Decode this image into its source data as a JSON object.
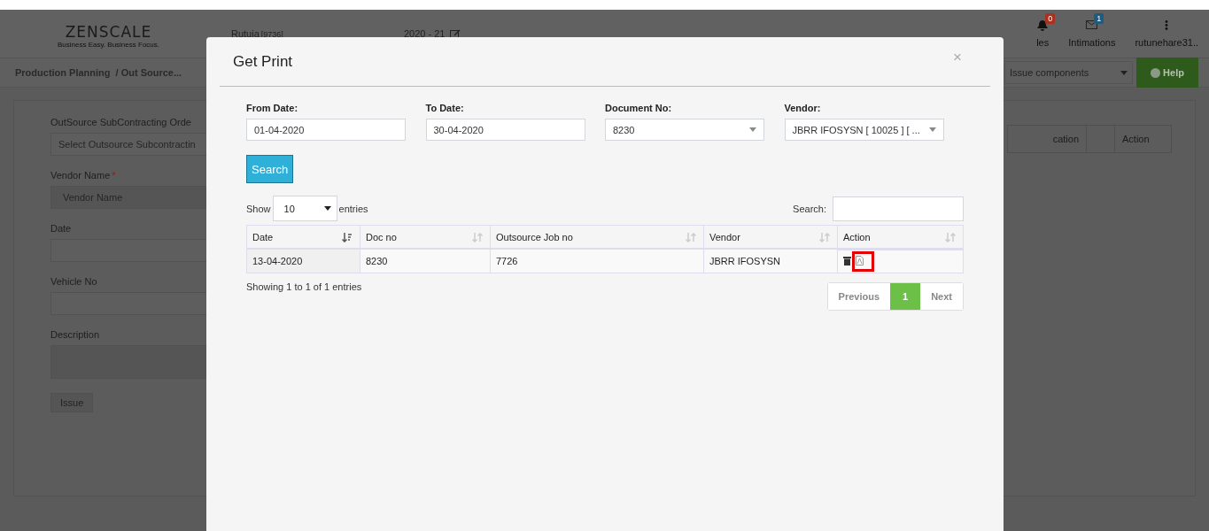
{
  "header": {
    "logo": "ZENSCALE",
    "tagline": "Business Easy. Business Focus.",
    "user": "Rutuja",
    "user_id": "[9736]",
    "year": "2020 - 21",
    "items": [
      {
        "kind": "bell",
        "label": "les",
        "badge": "0",
        "color": "#a8321f"
      },
      {
        "kind": "mail",
        "label": "Intimations",
        "badge": "1",
        "color": "#1f5a7f"
      },
      {
        "kind": "dots",
        "label": "rutunehare31.."
      }
    ]
  },
  "breadcrumb": [
    "Production Planning",
    "/ Out Source..."
  ],
  "type_select": {
    "value": "Issue components"
  },
  "help_button": "Help",
  "form": {
    "order_label": "OutSource SubContracting Orde",
    "order_placeholder": "Select Outsource Subcontractin",
    "vendor_label": "Vendor Name",
    "vendor_required": true,
    "vendor_required_mark": "*",
    "vendor_placeholder": "Vendor Name",
    "date_label": "Date",
    "vehicle_label": "Vehicle No",
    "description_label": "Description",
    "issue_button": "Issue"
  },
  "background_table": {
    "columns": [
      "cation",
      "",
      "Action"
    ]
  },
  "modal": {
    "title": "Get Print",
    "close": "×",
    "filters": [
      {
        "label": "From Date:",
        "value": "01-04-2020",
        "kind": "input"
      },
      {
        "label": "To Date:",
        "value": "30-04-2020",
        "kind": "input"
      },
      {
        "label": "Document No:",
        "value": "8230",
        "kind": "select"
      },
      {
        "label": "Vendor:",
        "value": "JBRR IFOSYSN [ 10025 ] [ ...",
        "kind": "select"
      }
    ],
    "search_button": "Search",
    "length": {
      "show": "Show",
      "value": "10",
      "entries": "entries"
    },
    "search_label": "Search:",
    "columns": [
      {
        "label": "Date",
        "sorted": true
      },
      {
        "label": "Doc no",
        "sorted": false
      },
      {
        "label": "Outsource Job no",
        "sorted": false
      },
      {
        "label": "Vendor",
        "sorted": false
      },
      {
        "label": "Action",
        "sorted": false
      }
    ],
    "rows": [
      {
        "date": "13-04-2020",
        "doc_no": "8230",
        "job_no": "7726",
        "vendor": "JBRR IFOSYSN",
        "pdf_highlighted": true
      }
    ],
    "info": "Showing 1 to 1 of 1 entries",
    "pages": [
      {
        "label": "Previous",
        "selected": false
      },
      {
        "label": "1",
        "selected": true
      },
      {
        "label": "Next",
        "selected": false
      }
    ]
  }
}
